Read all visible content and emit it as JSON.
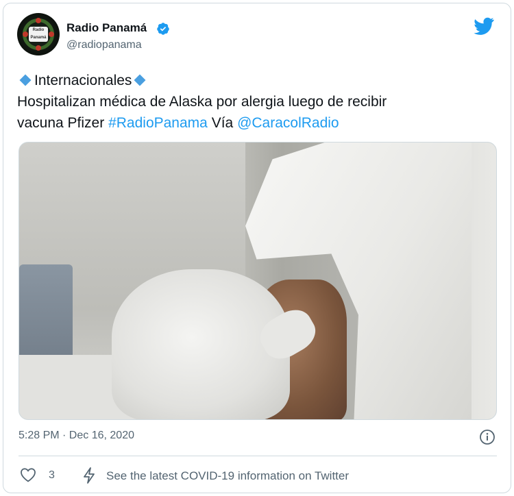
{
  "account": {
    "name": "Radio Panamá",
    "handle": "@radiopanama",
    "verified": true,
    "avatar_text": "Radio Panamá"
  },
  "tweet": {
    "line1": "Internacionales",
    "line2": "Hospitalizan médica de Alaska por alergia luego de recibir",
    "line3_prefix": "vacuna Pfizer",
    "hashtag": "#RadioPanama",
    "via": "Vía",
    "mention": "@CaracolRadio"
  },
  "timestamp": "5:28 PM · Dec 16, 2020",
  "actions": {
    "likes": "3",
    "covid_info": "See the latest COVID-19 information on Twitter"
  },
  "colors": {
    "link": "#1d9bf0",
    "muted": "#536471",
    "border": "#cfd9de",
    "diamond": "#4a9fe0"
  },
  "icons": [
    "verified-badge-icon",
    "twitter-bird-icon",
    "info-icon",
    "heart-icon",
    "bolt-icon"
  ]
}
